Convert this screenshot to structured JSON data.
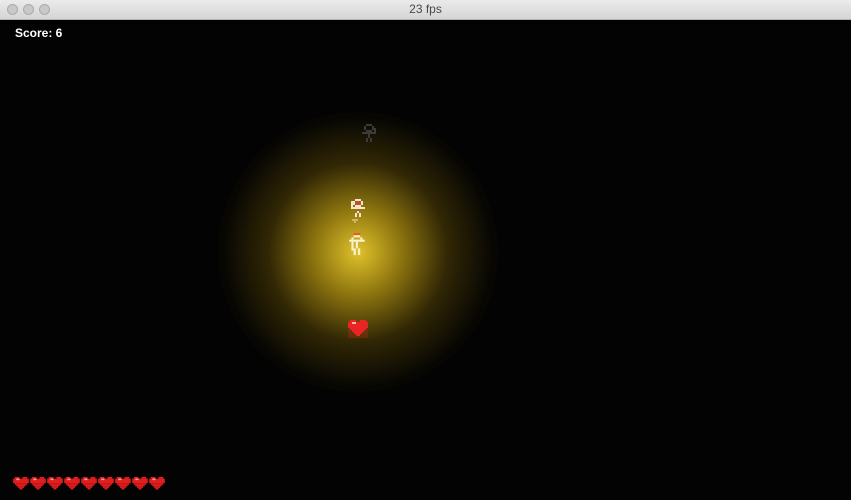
{
  "window": {
    "title": "23 fps"
  },
  "hud": {
    "score_text": "Score: 6",
    "health_hearts": 9,
    "health_icon": "heart-icon"
  },
  "entities": [
    {
      "name": "player",
      "icon": "knight-icon"
    },
    {
      "name": "ally",
      "icon": "knight-icon"
    },
    {
      "name": "distant-enemy",
      "icon": "knight-icon"
    },
    {
      "name": "heart-pickup",
      "icon": "heart-icon"
    }
  ],
  "colors": {
    "background": "#030303",
    "light": "#e8c832",
    "heart": "#e21d1d",
    "score": "#ffffff"
  }
}
